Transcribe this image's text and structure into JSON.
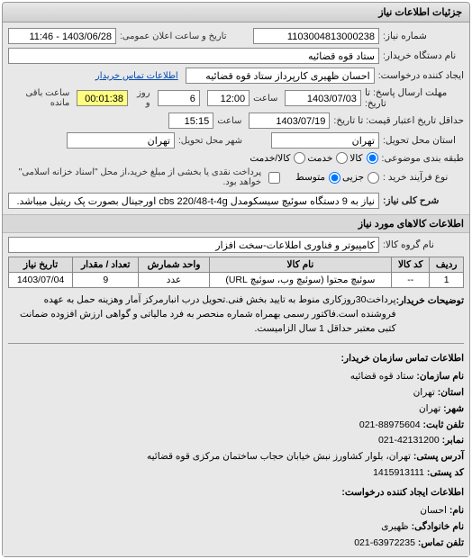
{
  "panel_title": "جزئیات اطلاعات نیاز",
  "req_no_lbl": "شماره نیاز:",
  "req_no": "1103004813000238",
  "announce_lbl": "تاریخ و ساعت اعلان عمومی:",
  "announce_val": "1403/06/28 - 11:46",
  "buyer_lbl": "نام دستگاه خریدار:",
  "buyer_val": "ستاد قوه قضائیه",
  "creator_lbl": "ایجاد کننده درخواست:",
  "creator_val": "احسان ظهیری کارپرداز ستاد قوه قضائیه",
  "buyer_contact_lbl": "اطلاعات تماس خریدار",
  "deadline_lbl": "مهلت ارسال پاسخ: تا تاریخ:",
  "deadline_date": "1403/07/03",
  "time_lbl": "ساعت",
  "deadline_time": "12:00",
  "remain_day": "6",
  "remain_day_lbl": "روز و",
  "remain_time": "00:01:38",
  "remain_time_lbl": "ساعت باقی مانده",
  "valid_lbl": "حداقل تاریخ اعتبار قیمت: تا تاریخ:",
  "valid_date": "1403/07/19",
  "valid_time": "15:15",
  "delivery_state_lbl": "استان محل تحویل:",
  "delivery_state": "تهران",
  "delivery_city_lbl": "شهر محل تحویل:",
  "delivery_city": "تهران",
  "priority_lbl": "طبقه بندی موضوعی:",
  "p_goods": "کالا",
  "p_service": "خدمت",
  "p_both": "کالا/خدمت",
  "buy_type_lbl": "نوع فرآیند خرید :",
  "bt_small": "جزیی",
  "bt_med": "متوسط",
  "bt_note": "پرداخت نقدی یا بخشی از مبلغ خرید،از محل \"اسناد خزانه اسلامی\" خواهد بود.",
  "subject_lbl": "شرح کلی نیاز:",
  "subject_val": "نیاز به 9 دستگاه سوئیچ سیسکومدل cbs 220/48-t-4g اورجینال بصورت پک ریتیل میباشد.",
  "goods_section": "اطلاعات کالاهای مورد نیاز",
  "group_lbl": "نام گروه کالا:",
  "group_val": "کامپیوتر و فناوری اطلاعات-سخت افزار",
  "th_row": "ردیف",
  "th_code": "کد کالا",
  "th_name": "نام کالا",
  "th_unit": "واحد شمارش",
  "th_qty": "تعداد / مقدار",
  "th_date": "تاریخ نیاز",
  "r_row": "1",
  "r_code": "--",
  "r_name": "سوئیچ مجتوا (سوئیچ وب، سوئیچ URL)",
  "r_unit": "عدد",
  "r_qty": "9",
  "r_date": "1403/07/04",
  "notes_lbl": "توضیحات خریدار:",
  "notes_val": "پرداخت30روزکاری منوط به تایید بخش فنی.تحویل درب انبارمرکز آمار وهزینه حمل به عهده فروشنده است.فاکتور رسمی بهمراه شماره منحصر به فرد مالیاتی و گواهی ارزش افزوده ضمانت کتبی معتبر حداقل 1 سال الزامیست.",
  "contact_title": "اطلاعات تماس سازمان خریدار:",
  "c_org_lbl": "نام سازمان:",
  "c_org": "ستاد قوه قضائیه",
  "c_state_lbl": "استان:",
  "c_state": "تهران",
  "c_city_lbl": "شهر:",
  "c_city": "تهران",
  "c_tel_lbl": "تلفن ثابت:",
  "c_tel": "021-88975604",
  "c_fax_lbl": "نمابر:",
  "c_fax": "021-42131200",
  "c_addr_lbl": "آدرس پستی:",
  "c_addr": "تهران، بلوار کشاورز نبش خیابان حجاب ساختمان مرکزی قوه قضائیه",
  "c_zip_lbl": "کد پستی:",
  "c_zip": "1415913111",
  "creator_contact_title": "اطلاعات ایجاد کننده درخواست:",
  "cc_name_lbl": "نام:",
  "cc_name": "احسان",
  "cc_family_lbl": "نام خانوادگی:",
  "cc_family": "ظهیری",
  "cc_tel_lbl": "تلفن تماس:",
  "cc_tel": "021-63972235"
}
